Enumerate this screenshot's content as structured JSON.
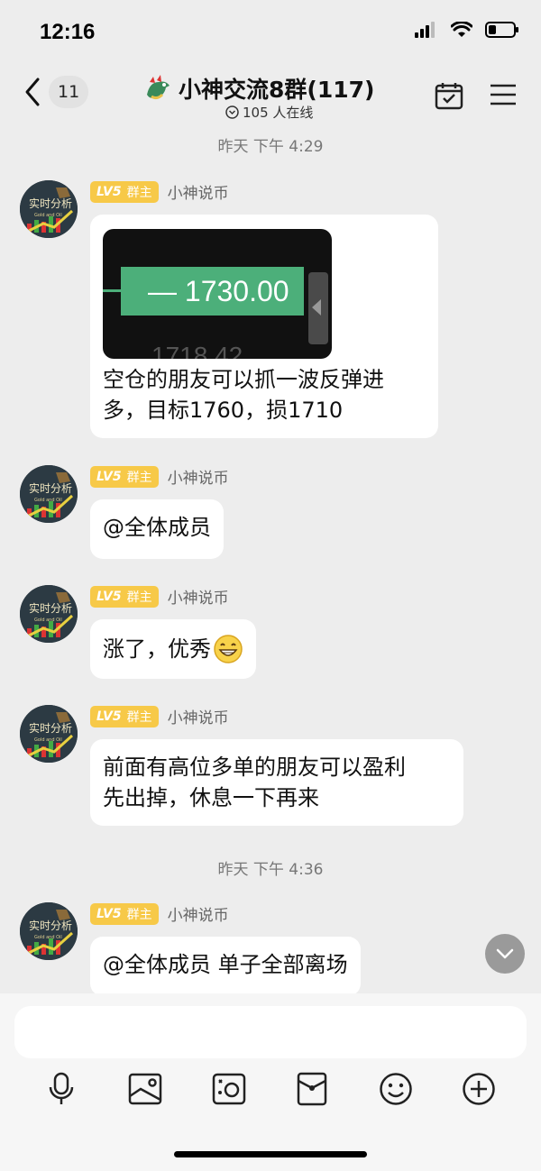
{
  "status_bar": {
    "time": "12:16"
  },
  "nav": {
    "unread_count": "11",
    "group_title": "小神交流8群(117)",
    "online_text": "105 人在线"
  },
  "sender": {
    "level": "LV5",
    "role": "群主",
    "name": "小神说币"
  },
  "timestamps": [
    "昨天 下午 4:29",
    "昨天 下午 4:36"
  ],
  "messages": [
    {
      "image": {
        "price_main": "1730.00",
        "price_lower": "1718.42"
      },
      "text_line1": "空仓的朋友可以抓一波反弹进",
      "text_line2": "多，目标1760，损1710"
    },
    {
      "text": "@全体成员"
    },
    {
      "text": "涨了，优秀"
    },
    {
      "text_line1": "前面有高位多单的朋友可以盈利",
      "text_line2": "先出掉，休息一下再来"
    },
    {
      "text": "@全体成员 单子全部离场"
    }
  ],
  "avatar_text": {
    "top": "实时分析",
    "sub": "Gold and Oil"
  },
  "composer": {
    "placeholder": ""
  },
  "toolbar": [
    "voice-icon",
    "image-icon",
    "camera-icon",
    "red-packet-icon",
    "emoji-icon",
    "plus-icon"
  ]
}
